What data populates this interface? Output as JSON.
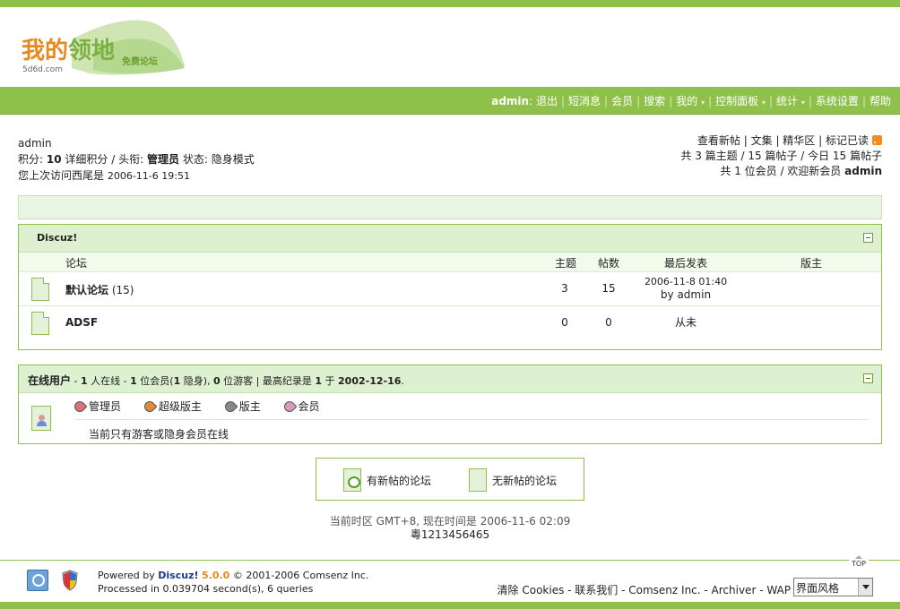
{
  "logo": {
    "text_part1": "我的",
    "text_part2": "领地",
    "domain": "5d6d.com",
    "tagline": "免费论坛"
  },
  "nav": {
    "user": "admin",
    "items": [
      "退出",
      "短消息",
      "会员",
      "搜索",
      "我的",
      "控制面板",
      "统计",
      "系统设置",
      "帮助"
    ]
  },
  "user_panel": {
    "username": "admin",
    "points_label": "积分:",
    "points_value": "10",
    "points_detail": "详细积分",
    "title_label": "/ 头衔:",
    "title_value": "管理员",
    "status_label": "状态:",
    "status_value": "隐身模式",
    "last_visit_label": "您上次访问西尾是",
    "last_visit_time": "2006-11-6 19:51"
  },
  "right_panel": {
    "links": [
      "查看新帖",
      "文集",
      "精华区",
      "标记已读"
    ],
    "stats_line": "共 3 篇主题 / 15 篇帖子 / 今日 15 篇帖子",
    "members_line": "共 1 位会员 / 欢迎新会员",
    "new_member": "admin"
  },
  "forum_box": {
    "title": "Discuz!",
    "headers": {
      "forum": "论坛",
      "topics": "主题",
      "posts": "帖数",
      "last_post": "最后发表",
      "moderator": "版主"
    },
    "rows": [
      {
        "name": "默认论坛",
        "today": "(15)",
        "topics": "3",
        "posts": "15",
        "last_time": "2006-11-8 01:40",
        "last_by": "by admin"
      },
      {
        "name": "ADSF",
        "today": "",
        "topics": "0",
        "posts": "0",
        "never": "从未"
      }
    ]
  },
  "online_box": {
    "title": "在线用户",
    "p1": "- ",
    "online_count": "1",
    "p2": " 人在线 - ",
    "members": "1",
    "p3": " 位会员(",
    "hidden": "1",
    "p4": " 隐身), ",
    "guests": "0",
    "p5": " 位游客 | 最高纪录是 ",
    "record": "1",
    "p6": " 于 ",
    "record_date": "2002-12-16",
    "p7": ".",
    "legend": [
      "管理员",
      "超级版主",
      "版主",
      "会员"
    ],
    "message": "当前只有游客或隐身会员在线"
  },
  "legend_box": {
    "new_label": "有新帖的论坛",
    "nonew_label": "无新帖的论坛"
  },
  "footer_info": {
    "timezone_line": "当前时区 GMT+8, 现在时间是 2006-11-6 02:09",
    "code": "粵1213456465"
  },
  "footer": {
    "top_label": "TOP",
    "powered_by": "Powered by",
    "discuz": "Discuz!",
    "version": "5.0.0",
    "copyright": "© 2001-2006 Comsenz Inc.",
    "processed": "Processed in 0.039704 second(s), 6 queries",
    "links": "清除 Cookies - 联系我们 - Comsenz Inc. - Archiver - WAP",
    "style_select": "界面风格"
  },
  "colors": {
    "accent": "#8fc04a",
    "light_green": "#ddf0d0"
  }
}
